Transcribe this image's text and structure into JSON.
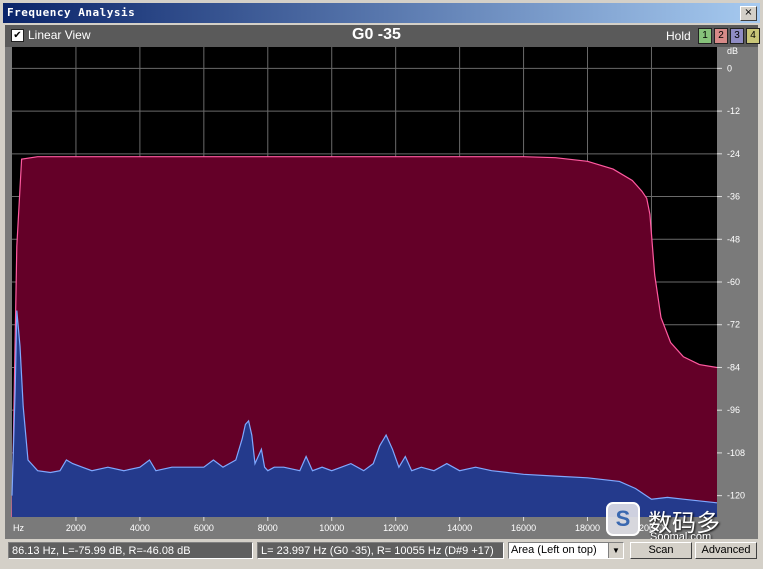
{
  "window": {
    "title": "Frequency Analysis",
    "close_glyph": "×"
  },
  "toolbar": {
    "linear_view_checked": "✔",
    "linear_view_label": "Linear View",
    "note_label": "G0 -35",
    "hold_label": "Hold",
    "hold_buttons": [
      {
        "label": "1",
        "color": "#86c27a"
      },
      {
        "label": "2",
        "color": "#d78a88"
      },
      {
        "label": "3",
        "color": "#8f8cc4"
      },
      {
        "label": "4",
        "color": "#c9c678"
      }
    ]
  },
  "status": {
    "cursor_readout": "86.13 Hz, L=-75.99 dB, R=-46.08 dB",
    "peak_readout": "L= 23.997 Hz (G0 -35), R=  10055 Hz (D#9 +17)",
    "display_mode": "Area (Left on top)",
    "scan_label": "Scan",
    "advanced_label": "Advanced"
  },
  "watermark": {
    "icon_glyph": "S",
    "cn": "数码多",
    "en": "Soomal.com"
  },
  "chart_data": {
    "type": "area",
    "xlabel": "Hz",
    "ylabel": "dB",
    "xlim": [
      0,
      22050
    ],
    "ylim": [
      -126,
      6
    ],
    "x_ticks": [
      2000,
      4000,
      6000,
      8000,
      10000,
      12000,
      14000,
      16000,
      18000,
      20000
    ],
    "x_tick_labels": [
      "2000",
      "4000",
      "6000",
      "8000",
      "10000",
      "12000",
      "14000",
      "16000",
      "18000",
      "20000"
    ],
    "y_ticks": [
      0,
      -12,
      -24,
      -36,
      -48,
      -60,
      -72,
      -84,
      -96,
      -108,
      -120
    ],
    "y_tick_labels": [
      "0",
      "-12",
      "-24",
      "-36",
      "-48",
      "-60",
      "-72",
      "-84",
      "-96",
      "-108",
      "-120"
    ],
    "grid": true,
    "colors": {
      "background": "#000000",
      "grid": "#6a6a6a",
      "right_fill": "#640028",
      "right_line": "#ff5aa0",
      "left_fill": "#243a8c",
      "left_line": "#7fa8ff"
    },
    "series": [
      {
        "name": "R",
        "x": [
          0,
          150,
          300,
          800,
          2000,
          4000,
          6000,
          8000,
          10000,
          12000,
          14000,
          16000,
          17000,
          18000,
          18800,
          19400,
          19700,
          19850,
          19950,
          20100,
          20300,
          20600,
          21000,
          21500,
          22050
        ],
        "values": [
          -126,
          -50,
          -25.5,
          -24.8,
          -24.8,
          -24.8,
          -24.8,
          -24.8,
          -24.8,
          -24.8,
          -24.8,
          -24.8,
          -25.1,
          -26.1,
          -28.3,
          -31.5,
          -34.5,
          -36.5,
          -41,
          -58,
          -70,
          -77,
          -81,
          -83.2,
          -84
        ]
      },
      {
        "name": "L",
        "x": [
          0,
          100,
          150,
          250,
          350,
          500,
          800,
          1200,
          1500,
          1700,
          1900,
          2200,
          2500,
          3000,
          3500,
          4000,
          4300,
          4500,
          5000,
          5500,
          6000,
          6300,
          6600,
          7000,
          7200,
          7300,
          7400,
          7500,
          7600,
          7800,
          7900,
          8000,
          8200,
          8500,
          9000,
          9200,
          9400,
          9700,
          10000,
          10300,
          10600,
          11000,
          11300,
          11500,
          11700,
          11900,
          12100,
          12300,
          12500,
          12800,
          13200,
          13600,
          14000,
          14500,
          15000,
          16000,
          17000,
          18000,
          19000,
          19500,
          20000,
          20500,
          21000,
          22050
        ],
        "values": [
          -120,
          -90,
          -68,
          -78,
          -95,
          -110,
          -113,
          -113.5,
          -113,
          -110,
          -111,
          -112,
          -113,
          -112,
          -113,
          -112,
          -110,
          -113,
          -112,
          -112,
          -112,
          -110,
          -112,
          -110,
          -104,
          -100,
          -99,
          -103,
          -111,
          -107,
          -112,
          -113,
          -112,
          -112,
          -113,
          -109,
          -113,
          -112,
          -113,
          -112,
          -111,
          -113,
          -111,
          -106,
          -103,
          -107,
          -112,
          -109,
          -113,
          -112,
          -113,
          -111,
          -113,
          -112,
          -113,
          -114,
          -114.5,
          -115,
          -116,
          -118,
          -121,
          -120.5,
          -121,
          -122
        ]
      }
    ]
  }
}
